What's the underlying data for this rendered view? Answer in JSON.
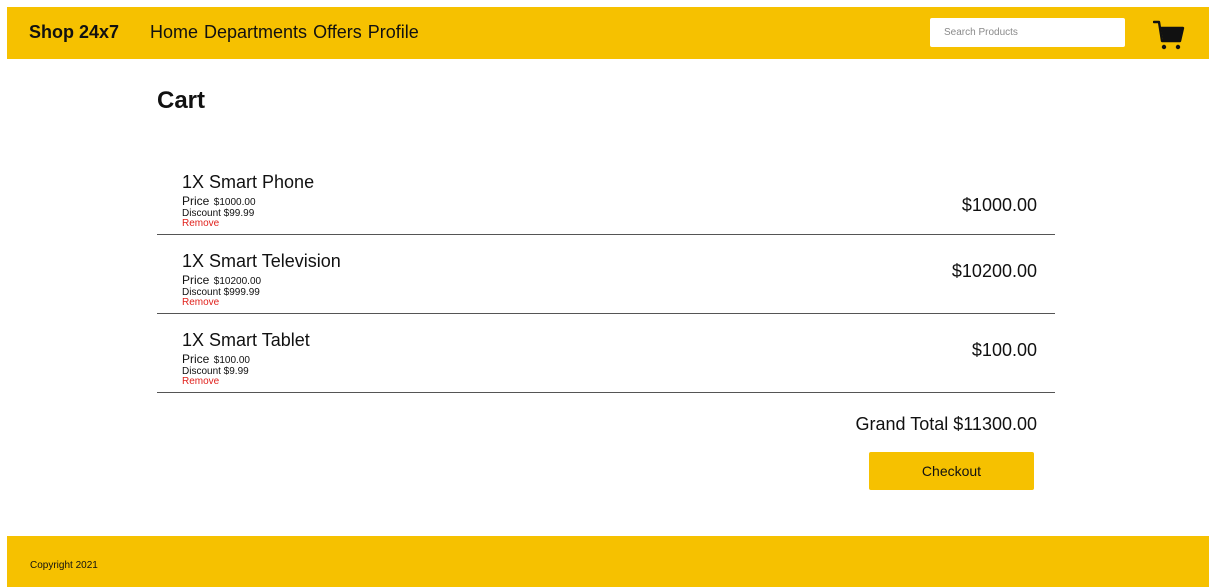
{
  "header": {
    "brand": "Shop 24x7",
    "nav": [
      "Home",
      "Departments",
      "Offers",
      "Profile"
    ],
    "search_placeholder": "Search Products",
    "cart_icon": "shopping-cart-icon"
  },
  "page_title": "Cart",
  "cart": {
    "items": [
      {
        "title": "1X Smart Phone",
        "price_label": "Price",
        "price": "$1000.00",
        "discount": "Discount $99.99",
        "remove": "Remove",
        "total": "$1000.00"
      },
      {
        "title": "1X Smart Television",
        "price_label": "Price",
        "price": "$10200.00",
        "discount": "Discount $999.99",
        "remove": "Remove",
        "total": "$10200.00"
      },
      {
        "title": "1X Smart Tablet",
        "price_label": "Price",
        "price": "$100.00",
        "discount": "Discount $9.99",
        "remove": "Remove",
        "total": "$100.00"
      }
    ],
    "grand_total": "Grand Total $11300.00",
    "checkout_label": "Checkout"
  },
  "footer": {
    "copyright": "Copyright 2021"
  },
  "colors": {
    "brand_yellow": "#f6c100",
    "remove_red": "#e0201b",
    "divider": "#555555"
  }
}
